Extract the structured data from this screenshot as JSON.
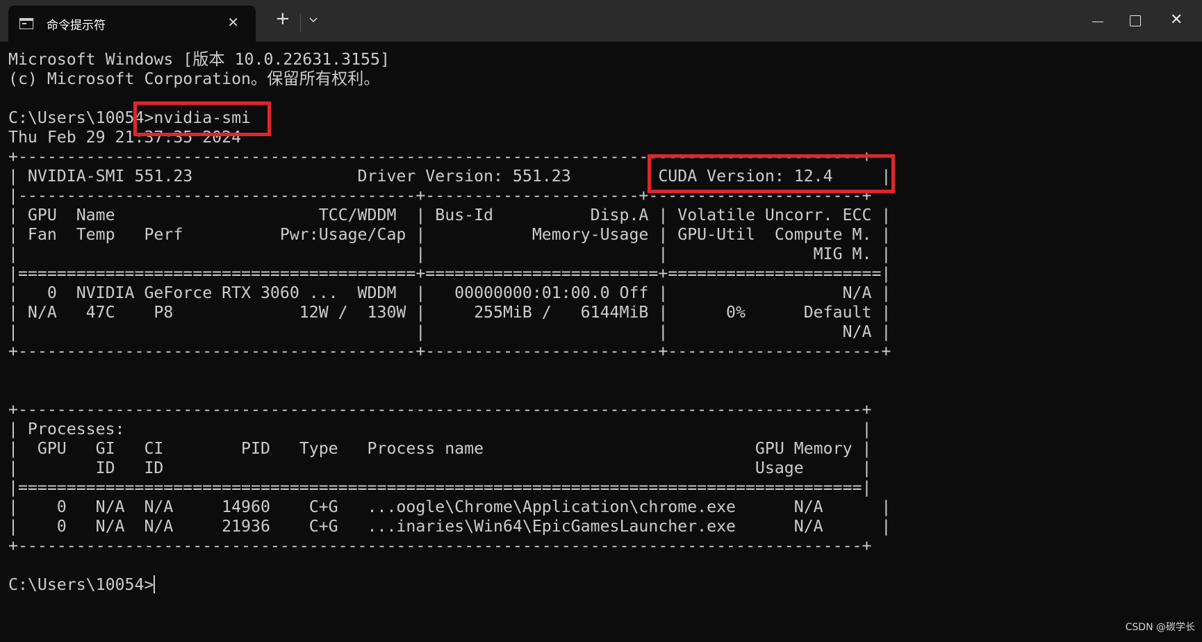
{
  "window": {
    "tab_title": "命令提示符",
    "tab_icon": "terminal-icon",
    "tab_close": "✕",
    "new_tab": "+",
    "close_symbol": "✕"
  },
  "terminal": {
    "lines": [
      "Microsoft Windows [版本 10.0.22631.3155]",
      "(c) Microsoft Corporation。保留所有权利。",
      "",
      "C:\\Users\\10054>nvidia-smi",
      "Thu Feb 29 21:37:35 2024",
      "+---------------------------------------------------------------------------------------+",
      "| NVIDIA-SMI 551.23                 Driver Version: 551.23         CUDA Version: 12.4     |",
      "|-----------------------------------------+----------------------+----------------------+",
      "| GPU  Name                     TCC/WDDM  | Bus-Id          Disp.A | Volatile Uncorr. ECC |",
      "| Fan  Temp   Perf          Pwr:Usage/Cap |           Memory-Usage | GPU-Util  Compute M. |",
      "|                                         |                        |               MIG M. |",
      "|=========================================+========================+======================|",
      "|   0  NVIDIA GeForce RTX 3060 ...  WDDM  |   00000000:01:00.0 Off |                  N/A |",
      "| N/A   47C    P8             12W /  130W |     255MiB /   6144MiB |      0%      Default |",
      "|                                         |                        |                  N/A |",
      "+-----------------------------------------+------------------------+----------------------+",
      "",
      "",
      "+---------------------------------------------------------------------------------------+",
      "| Processes:                                                                            |",
      "|  GPU   GI   CI        PID   Type   Process name                            GPU Memory |",
      "|        ID   ID                                                             Usage      |",
      "|=======================================================================================|",
      "|    0   N/A  N/A     14960    C+G   ...oogle\\Chrome\\Application\\chrome.exe      N/A      |",
      "|    0   N/A  N/A     21936    C+G   ...inaries\\Win64\\EpicGamesLauncher.exe      N/A      |",
      "+---------------------------------------------------------------------------------------+",
      "",
      "C:\\Users\\10054>"
    ]
  },
  "watermark": "CSDN @碳学长",
  "colors": {
    "background": "#0c0c0c",
    "titlebar": "#2b2b2b",
    "text": "#cccccc",
    "highlight": "#e0262b"
  }
}
